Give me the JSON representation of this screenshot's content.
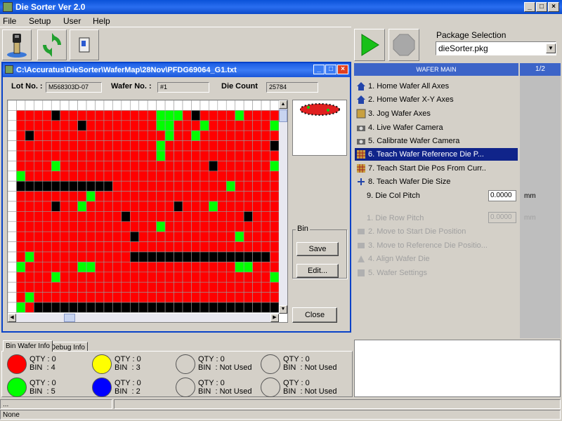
{
  "app": {
    "title": "Die Sorter Ver 2.0"
  },
  "menu": [
    "File",
    "Setup",
    "User",
    "Help"
  ],
  "package": {
    "label": "Package Selection",
    "value": "dieSorter.pkg"
  },
  "child_window": {
    "title": "C:\\Accuratus\\DieSorter\\WaferMap\\28Nov\\PFDG69064_G1.txt",
    "lot_label": "Lot No. :",
    "lot_value": "M568303D-07",
    "wafer_label": "Wafer No. :",
    "wafer_value": "#1",
    "die_label": "Die Count",
    "die_value": "25784",
    "bin_label": "Bin",
    "save": "Save",
    "edit": "Edit...",
    "close": "Close"
  },
  "wafer_map": {
    "colors": {
      "R": "#ff0000",
      "G": "#00ff00",
      "K": "#000000",
      "W": "#ffffff"
    },
    "rows": [
      "WWWWWWWWWWWWWWWWWWWWWWWWWWWWWWW",
      "WRRRRKRRRRRRRRRRRGGGRKRRRRGRRRR",
      "WRRRRRRRKRRRRRRRRGGRRRGRRRRRRRG",
      "WRKRRRRRRRRRRRRRRRGRRGRRRRRRRRR",
      "WRRRRRRRRRRRRRRRRGRRRRRRRRRRRRK",
      "WRRRRRRRRRRRRRRRRGRRRRRRRRRRRRR",
      "WRRRRGRRRRRRRRRRRRRRRRRKRRRRRRG",
      "WGRRRRRRRRRRRRRRRRRRRRRRRRRRRRR",
      "WKKKKKKKKKKKRRRRRRRRRRRRRGRRRRR",
      "WRRRRRRRRGRRRRRRRRRRRRRRRRRRRRR",
      "WRRRRKRRGRRRRRRRRRRKRRRGRRRRRRR",
      "WRRRRRRRRRRRRKRRRRRRRRRRRRRKRRR",
      "WRRRRRRRRRRRRRRRRGRRRRRRRRRRRRR",
      "WRRRRRRRRRRRRRKRRRRRRRRRRRGRRRR",
      "WRRRRRRRRRRRRRRRRRRRRRRRRRRRRRR",
      "WRGRRRRRRRRRRRKKKKKKKKKKKKKKKKR",
      "WGRRRRRRGGRRRRRRRRRRRRRRRRGGRRR",
      "WRRRRGRRRRRRRRRRRRRRRRRRRRRRRRG",
      "WRRRRRRRRRRRRRRRRRRRRRRRRRRRRRR",
      "WRGRRRRRRRRRRRRRRRRRRRRRRRRRRRR",
      "WGRKKKKKKKKKKKKKKKKKKKKKKKKKKKK"
    ]
  },
  "right_panel": {
    "header": "WAFER MAIN",
    "page": "1/2",
    "items": [
      {
        "label": "1. Home Wafer All Axes",
        "icon": "home-icon",
        "disabled": false,
        "selected": false
      },
      {
        "label": "2. Home Wafer X-Y Axes",
        "icon": "home-icon",
        "disabled": false,
        "selected": false
      },
      {
        "label": "3. Jog Wafer Axes",
        "icon": "jog-icon",
        "disabled": false,
        "selected": false
      },
      {
        "label": "4. Live Wafer Camera",
        "icon": "camera-icon",
        "disabled": false,
        "selected": false
      },
      {
        "label": "5. Calibrate Wafer Camera",
        "icon": "camera-icon",
        "disabled": false,
        "selected": false
      },
      {
        "label": "6. Teach Wafer Reference Die P...",
        "icon": "grid-icon",
        "disabled": false,
        "selected": true
      },
      {
        "label": "7. Teach Start Die Pos From Curr..",
        "icon": "grid-icon",
        "disabled": false,
        "selected": false
      },
      {
        "label": "8. Teach Wafer Die Size",
        "icon": "resize-icon",
        "disabled": false,
        "selected": false
      },
      {
        "label": "9. Die Col Pitch",
        "icon": "",
        "disabled": false,
        "selected": false
      },
      {
        "label": "1. Die Row Pitch",
        "icon": "",
        "disabled": true,
        "selected": false
      },
      {
        "label": "2. Move to Start Die Position",
        "icon": "move-icon",
        "disabled": true,
        "selected": false
      },
      {
        "label": "3. Move to Reference Die Positio...",
        "icon": "move-icon",
        "disabled": true,
        "selected": false
      },
      {
        "label": "4. Align Wafer Die",
        "icon": "align-icon",
        "disabled": true,
        "selected": false
      },
      {
        "label": "5. Wafer Settings",
        "icon": "settings-icon",
        "disabled": true,
        "selected": false
      }
    ],
    "col_pitch_value": "0.0000",
    "row_pitch_value": "0.0000",
    "unit": "mm"
  },
  "tabs": [
    "Bin Wafer Info",
    "Debug Info"
  ],
  "bins": [
    {
      "qty_label": "QTY",
      "qty": ": 0",
      "bin_label": "BIN",
      "bin": ": 4",
      "color": "#ff0000"
    },
    {
      "qty_label": "QTY",
      "qty": ": 0",
      "bin_label": "BIN",
      "bin": ": 3",
      "color": "#ffff00"
    },
    {
      "qty_label": "QTY",
      "qty": ": 0",
      "bin_label": "BIN",
      "bin": ": Not Used",
      "color": ""
    },
    {
      "qty_label": "QTY",
      "qty": ": 0",
      "bin_label": "BIN",
      "bin": ": Not Used",
      "color": ""
    },
    {
      "qty_label": "QTY",
      "qty": ": 0",
      "bin_label": "BIN",
      "bin": ": 5",
      "color": "#00ff00"
    },
    {
      "qty_label": "QTY",
      "qty": ": 0",
      "bin_label": "BIN",
      "bin": ": 2",
      "color": "#0000ff"
    },
    {
      "qty_label": "QTY",
      "qty": ": 0",
      "bin_label": "BIN",
      "bin": ": Not Used",
      "color": ""
    },
    {
      "qty_label": "QTY",
      "qty": ": 0",
      "bin_label": "BIN",
      "bin": ": Not Used",
      "color": ""
    }
  ],
  "status": {
    "line1": "...",
    "line2": "None"
  }
}
